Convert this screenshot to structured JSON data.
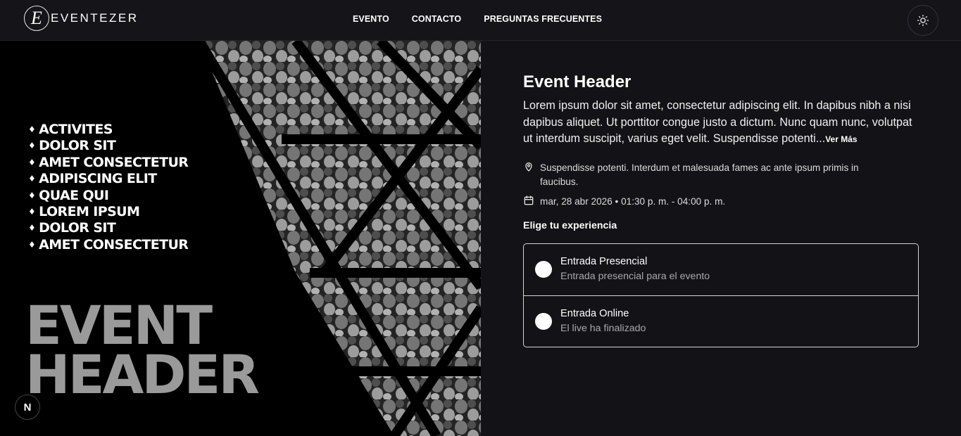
{
  "brand": {
    "logo_letter": "E",
    "name": "EVENTEZER"
  },
  "nav": {
    "links": [
      "EVENTO",
      "CONTACTO",
      "PREGUNTAS FRECUENTES"
    ]
  },
  "theme_toggle": {
    "icon": "sun-icon"
  },
  "hero": {
    "activities": [
      "ACTIVITES",
      "DOLOR SIT",
      "AMET CONSECTETUR",
      "ADIPISCING ELIT",
      "QUAE QUI",
      "LOREM IPSUM",
      "DOLOR SIT",
      "AMET CONSECTETUR"
    ],
    "title_line1": "EVENT",
    "title_line2": "HEADER",
    "badge": "N"
  },
  "event": {
    "title": "Event Header",
    "description": "Lorem ipsum dolor sit amet, consectetur adipiscing elit. In dapibus nibh a nisi dapibus aliquet. Ut porttitor congue justo a dictum. Nunc quam nunc, volutpat ut interdum suscipit, varius eget velit. Suspendisse potenti...",
    "ver_mas": "Ver Más",
    "location_icon": "map-pin-icon",
    "location": "Suspendisse potenti. Interdum et malesuada fames ac ante ipsum primis in faucibus.",
    "date_icon": "calendar-icon",
    "datetime": "mar, 28 abr 2026 • 01:30 p. m. - 04:00 p. m."
  },
  "experience": {
    "label": "Elige tu experiencia",
    "options": [
      {
        "title": "Entrada Presencial",
        "subtitle": "Entrada presencial para el evento"
      },
      {
        "title": "Entrada Online",
        "subtitle": "El live ha finalizado"
      }
    ]
  },
  "colors": {
    "background": "#131317",
    "navbar": "#141419",
    "muted_text": "#a8a8ad",
    "border": "#d6d6d6"
  }
}
